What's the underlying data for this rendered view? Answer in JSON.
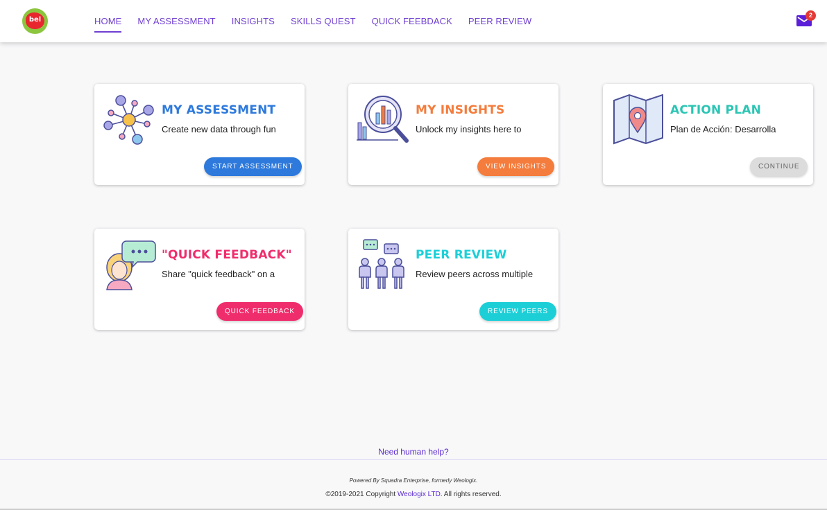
{
  "logo": {
    "text": "bel"
  },
  "nav": {
    "items": [
      {
        "label": "HOME",
        "active": true
      },
      {
        "label": "MY ASSESSMENT",
        "active": false
      },
      {
        "label": "INSIGHTS",
        "active": false
      },
      {
        "label": "SKILLS QUEST",
        "active": false
      },
      {
        "label": "QUICK FEEBDACK",
        "active": false
      },
      {
        "label": "PEER REVIEW",
        "active": false
      }
    ]
  },
  "mail": {
    "icon": "envelope-icon",
    "badge_count": "2"
  },
  "cards": [
    {
      "title": "MY ASSESSMENT",
      "description": "Create new data through fun",
      "button": "START ASSESSMENT",
      "color": "#2d79dc",
      "icon": "network-nodes-icon"
    },
    {
      "title": "MY INSIGHTS",
      "description": "Unlock my insights here to",
      "button": "VIEW INSIGHTS",
      "color": "#f47c3c",
      "icon": "magnifier-chart-icon"
    },
    {
      "title": "ACTION PLAN",
      "description": "Plan de Acción: Desarrolla",
      "button": "CONTINUE",
      "color": "#2bc5b4",
      "button_color": "#dcdcdc",
      "icon": "map-pin-icon"
    },
    {
      "title": "\"QUICK FEEDBACK\"",
      "description": "Share \"quick feedback\" on a",
      "button": "QUICK FEEDBACK",
      "color": "#ef2d6c",
      "icon": "person-speech-icon"
    },
    {
      "title": "PEER REVIEW",
      "description": "Review peers across multiple",
      "button": "REVIEW PEERS",
      "color": "#1ccfd7",
      "icon": "people-chat-icon"
    }
  ],
  "footer": {
    "help": "Need human help?",
    "powered_by": "Powered By Squadra Enterprise, formerly Weologix.",
    "copyright_prefix": "©2019-2021 Copyright ",
    "company_link": "Weologix LTD",
    "copyright_suffix": ". All rights reserved."
  }
}
